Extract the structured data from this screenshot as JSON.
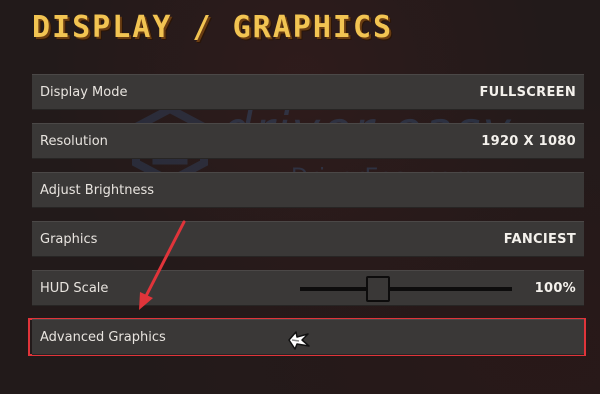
{
  "header": {
    "title": "DISPLAY / GRAPHICS"
  },
  "settings": [
    {
      "label": "Display Mode",
      "value": "FULLSCREEN"
    },
    {
      "label": "Resolution",
      "value": "1920 X 1080"
    },
    {
      "label": "Adjust Brightness",
      "value": ""
    },
    {
      "label": "Graphics",
      "value": "FANCIEST"
    },
    {
      "label": "HUD Scale",
      "value": "100%",
      "slider_level": 0.37
    },
    {
      "label": "Advanced Graphics",
      "value": ""
    }
  ],
  "watermark": {
    "brand": "driver easy",
    "url": "www.DriverEasy.com"
  },
  "colors": {
    "title": "#f2c452",
    "panel": "#3a3837",
    "highlight": "#e0343a",
    "text": "#e8e4df"
  },
  "icons": {
    "cursor": "pointer-cursor-icon",
    "annotation": "red-arrow-icon"
  }
}
